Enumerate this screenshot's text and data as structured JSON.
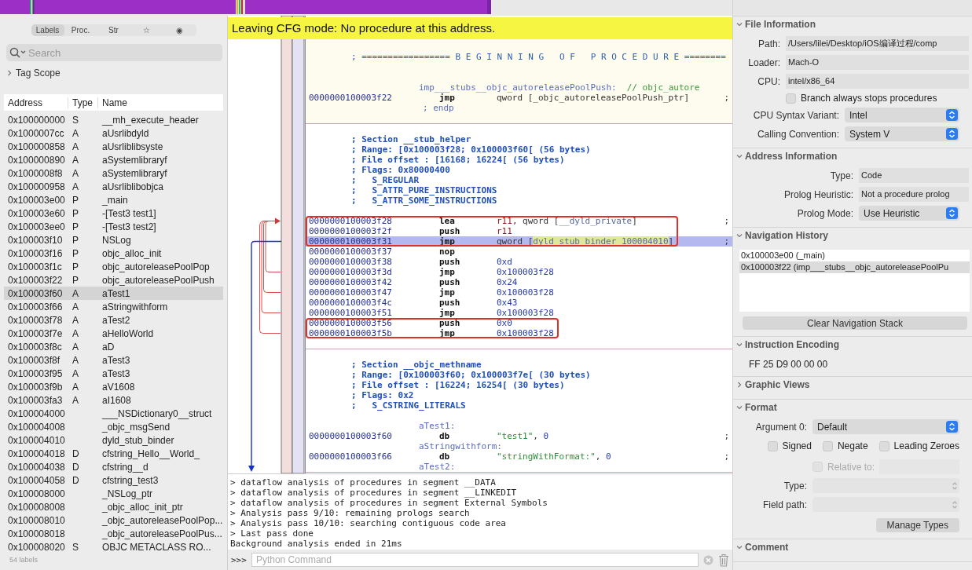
{
  "sidebar": {
    "tabs": [
      {
        "label": "Labels",
        "selected": true
      },
      {
        "label": "Proc.",
        "selected": false
      },
      {
        "label": "Str",
        "selected": false
      },
      {
        "label": "☆",
        "selected": false
      },
      {
        "label": "◉",
        "selected": false
      }
    ],
    "search": {
      "placeholder": "Search"
    },
    "tag_scope": {
      "label": "Tag Scope",
      "expanded": false
    },
    "table": {
      "columns": [
        "Address",
        "Type",
        "Name"
      ],
      "rows": [
        {
          "address": "0x100000000",
          "type": "S",
          "name": "__mh_execute_header",
          "selected": false
        },
        {
          "address": "0x1000007cc",
          "type": "A",
          "name": "aUsrlibdyld",
          "selected": false
        },
        {
          "address": "0x100000858",
          "type": "A",
          "name": "aUsrliblibsyste",
          "selected": false
        },
        {
          "address": "0x100000890",
          "type": "A",
          "name": "aSystemlibraryf",
          "selected": false
        },
        {
          "address": "0x1000008f8",
          "type": "A",
          "name": "aSystemlibraryf",
          "selected": false
        },
        {
          "address": "0x100000958",
          "type": "A",
          "name": "aUsrliblibobjca",
          "selected": false
        },
        {
          "address": "0x100003e00",
          "type": "P",
          "name": "_main",
          "selected": false
        },
        {
          "address": "0x100003e60",
          "type": "P",
          "name": "-[Test3 test1]",
          "selected": false
        },
        {
          "address": "0x100003ee0",
          "type": "P",
          "name": "-[Test3 test2]",
          "selected": false
        },
        {
          "address": "0x100003f10",
          "type": "P",
          "name": "NSLog",
          "selected": false
        },
        {
          "address": "0x100003f16",
          "type": "P",
          "name": "objc_alloc_init",
          "selected": false
        },
        {
          "address": "0x100003f1c",
          "type": "P",
          "name": "objc_autoreleasePoolPop",
          "selected": false
        },
        {
          "address": "0x100003f22",
          "type": "P",
          "name": "objc_autoreleasePoolPush",
          "selected": false
        },
        {
          "address": "0x100003f60",
          "type": "A",
          "name": "aTest1",
          "selected": true
        },
        {
          "address": "0x100003f66",
          "type": "A",
          "name": "aStringwithform",
          "selected": false
        },
        {
          "address": "0x100003f78",
          "type": "A",
          "name": "aTest2",
          "selected": false
        },
        {
          "address": "0x100003f7e",
          "type": "A",
          "name": "aHelloWorld",
          "selected": false
        },
        {
          "address": "0x100003f8c",
          "type": "A",
          "name": "aD",
          "selected": false
        },
        {
          "address": "0x100003f8f",
          "type": "A",
          "name": "aTest3",
          "selected": false
        },
        {
          "address": "0x100003f95",
          "type": "A",
          "name": "aTest3",
          "selected": false
        },
        {
          "address": "0x100003f9b",
          "type": "A",
          "name": "aV1608",
          "selected": false
        },
        {
          "address": "0x100003fa3",
          "type": "A",
          "name": "aI1608",
          "selected": false
        },
        {
          "address": "0x100004000",
          "name": "___NSDictionary0__struct",
          "selected": false
        },
        {
          "address": "0x100004008",
          "name": "_objc_msgSend",
          "selected": false
        },
        {
          "address": "0x100004010",
          "name": "dyld_stub_binder",
          "selected": false
        },
        {
          "address": "0x100004018",
          "type": "D",
          "name": "cfstring_Hello__World_",
          "selected": false
        },
        {
          "address": "0x100004038",
          "type": "D",
          "name": "cfstring__d",
          "selected": false
        },
        {
          "address": "0x100004058",
          "type": "D",
          "name": "cfstring_test3",
          "selected": false
        },
        {
          "address": "0x100008000",
          "name": "_NSLog_ptr",
          "selected": false
        },
        {
          "address": "0x100008008",
          "name": "_objc_alloc_init_ptr",
          "selected": false
        },
        {
          "address": "0x100008010",
          "name": "_objc_autoreleasePoolPop...",
          "selected": false
        },
        {
          "address": "0x100008018",
          "name": "_objc_autoreleasePoolPus...",
          "selected": false
        },
        {
          "address": "0x100008020",
          "type": "S",
          "name": "OBJC  METACLASS  RO...",
          "selected": false
        }
      ]
    },
    "footer": "54 labels"
  },
  "disassembly": {
    "banner": "Leaving CFG mode: No procedure at this address.",
    "blocks": [
      {
        "kind": "procedure",
        "lines": [
          {
            "kind": "heading",
            "text": "; ================= B E G I N N I N G   O F   P R O C E D U R E ========"
          },
          {
            "kind": "blank"
          },
          {
            "kind": "blank"
          },
          {
            "kind": "label",
            "text": "imp___stubs__objc_autoreleasePoolPush:",
            "note": "// objc_autore"
          },
          {
            "kind": "instr",
            "address": "0000000100003f22",
            "mnemonic": "jmp",
            "operands": [
              {
                "kind": "plain",
                "text": "qword [_objc_autoreleasePoolPush_ptr]"
              }
            ],
            "tail": ";",
            "selected": false
          },
          {
            "kind": "end",
            "text": "; endp"
          },
          {
            "kind": "blank"
          }
        ]
      },
      {
        "kind": "section",
        "lines": [
          {
            "kind": "blank"
          },
          {
            "kind": "comment",
            "text": "; Section __stub_helper"
          },
          {
            "kind": "comment",
            "text": "; Range: [0x100003f28; 0x100003f60[ (56 bytes)"
          },
          {
            "kind": "comment",
            "text": "; File offset : [16168; 16224[ (56 bytes)"
          },
          {
            "kind": "comment",
            "text": "; Flags: 0x80000400"
          },
          {
            "kind": "comment",
            "text": ";   S_REGULAR"
          },
          {
            "kind": "comment",
            "text": ";   S_ATTR_PURE_INSTRUCTIONS"
          },
          {
            "kind": "comment",
            "text": ";   S_ATTR_SOME_INSTRUCTIONS"
          },
          {
            "kind": "blank"
          },
          {
            "kind": "box",
            "lines": [
              {
                "kind": "instr",
                "address": "0000000100003f28",
                "mnemonic": "lea",
                "operands": [
                  {
                    "kind": "reg",
                    "text": "r11"
                  },
                  {
                    "kind": "plain",
                    "text": ", qword ["
                  },
                  {
                    "kind": "sym",
                    "text": "__dyld_private"
                  },
                  {
                    "kind": "plain",
                    "text": "]"
                  }
                ],
                "tail": ";",
                "selected": false
              },
              {
                "kind": "instr",
                "address": "0000000100003f2f",
                "mnemonic": "push",
                "operands": [
                  {
                    "kind": "reg",
                    "text": "r11"
                  }
                ],
                "selected": false
              },
              {
                "kind": "instr",
                "address": "0000000100003f31",
                "mnemonic": "jmp",
                "operands": [
                  {
                    "kind": "plain",
                    "text": "qword ["
                  },
                  {
                    "kind": "hl",
                    "text": "dyld_stub_binder_100004010"
                  },
                  {
                    "kind": "plain",
                    "text": "]"
                  }
                ],
                "tail": ";",
                "selected": true
              }
            ]
          },
          {
            "kind": "instr",
            "address": "0000000100003f37",
            "mnemonic": "nop",
            "selected": false
          },
          {
            "kind": "instr",
            "address": "0000000100003f38",
            "mnemonic": "push",
            "operands": [
              {
                "kind": "num",
                "text": "0xd"
              }
            ],
            "selected": false
          },
          {
            "kind": "instr",
            "address": "0000000100003f3d",
            "mnemonic": "jmp",
            "operands": [
              {
                "kind": "num",
                "text": "0x100003f28"
              }
            ],
            "selected": false
          },
          {
            "kind": "instr",
            "address": "0000000100003f42",
            "mnemonic": "push",
            "operands": [
              {
                "kind": "num",
                "text": "0x24"
              }
            ],
            "selected": false
          },
          {
            "kind": "instr",
            "address": "0000000100003f47",
            "mnemonic": "jmp",
            "operands": [
              {
                "kind": "num",
                "text": "0x100003f28"
              }
            ],
            "selected": false
          },
          {
            "kind": "instr",
            "address": "0000000100003f4c",
            "mnemonic": "push",
            "operands": [
              {
                "kind": "num",
                "text": "0x43"
              }
            ],
            "selected": false
          },
          {
            "kind": "instr",
            "address": "0000000100003f51",
            "mnemonic": "jmp",
            "operands": [
              {
                "kind": "num",
                "text": "0x100003f28"
              }
            ],
            "selected": false
          },
          {
            "kind": "box",
            "lines": [
              {
                "kind": "instr",
                "address": "0000000100003f56",
                "mnemonic": "push",
                "operands": [
                  {
                    "kind": "num",
                    "text": "0x0"
                  }
                ],
                "selected": false
              },
              {
                "kind": "instr",
                "address": "0000000100003f5b",
                "mnemonic": "jmp",
                "operands": [
                  {
                    "kind": "num",
                    "text": "0x100003f28"
                  }
                ],
                "selected": false
              }
            ]
          },
          {
            "kind": "blank"
          }
        ]
      },
      {
        "kind": "section",
        "lines": [
          {
            "kind": "blank"
          },
          {
            "kind": "comment",
            "text": "; Section __objc_methname"
          },
          {
            "kind": "comment",
            "text": "; Range: [0x100003f60; 0x100003f7e[ (30 bytes)"
          },
          {
            "kind": "comment",
            "text": "; File offset : [16224; 16254[ (30 bytes)"
          },
          {
            "kind": "comment",
            "text": "; Flags: 0x2"
          },
          {
            "kind": "comment",
            "text": ";   S_CSTRING_LITERALS"
          },
          {
            "kind": "blank"
          },
          {
            "kind": "label",
            "text": "aTest1:"
          },
          {
            "kind": "instr",
            "address": "0000000100003f60",
            "mnemonic": "db",
            "operands": [
              {
                "kind": "str",
                "text": "\"test1\""
              },
              {
                "kind": "plain",
                "text": ", "
              },
              {
                "kind": "num",
                "text": "0"
              }
            ],
            "tail": ";",
            "selected": false
          },
          {
            "kind": "label",
            "text": "aStringwithform:"
          },
          {
            "kind": "instr",
            "address": "0000000100003f66",
            "mnemonic": "db",
            "operands": [
              {
                "kind": "str",
                "text": "\"stringWithFormat:\""
              },
              {
                "kind": "plain",
                "text": ", "
              },
              {
                "kind": "num",
                "text": "0"
              }
            ],
            "tail": ";",
            "selected": false
          },
          {
            "kind": "label",
            "text": "aTest2:"
          }
        ]
      }
    ]
  },
  "console": {
    "lines": [
      "> dataflow analysis of procedures in segment __DATA",
      "> dataflow analysis of procedures in segment __LINKEDIT",
      "> dataflow analysis of procedures in segment External Symbols",
      "> Analysis pass 9/10: remaining prologs search",
      "> Analysis pass 10/10: searching contiguous code area",
      "> Last pass done",
      "Background analysis ended in 21ms"
    ],
    "prompt": ">>>",
    "placeholder": "Python Command"
  },
  "inspector": {
    "sections": [
      {
        "title": "File Information",
        "expanded": true,
        "rows": [
          {
            "kind": "field",
            "label": "Path:",
            "value": "/Users/lilei/Desktop/iOS编译过程/comp"
          },
          {
            "kind": "field",
            "label": "Loader:",
            "value": "Mach-O"
          },
          {
            "kind": "field",
            "label": "CPU:",
            "value": "intel/x86_64"
          },
          {
            "kind": "checkbox",
            "label": "Branch always stops procedures",
            "checked": false
          },
          {
            "kind": "popup",
            "label": "CPU Syntax Variant:",
            "value": "Intel",
            "disabled": false
          },
          {
            "kind": "popup",
            "label": "Calling Convention:",
            "value": "System V",
            "disabled": false
          }
        ]
      },
      {
        "title": "Address Information",
        "expanded": true,
        "rows": [
          {
            "kind": "field",
            "label": "Type:",
            "value": "Code"
          },
          {
            "kind": "field",
            "label": "Prolog Heuristic:",
            "value": "Not a procedure prolog"
          },
          {
            "kind": "popup",
            "label": "Prolog Mode:",
            "value": "Use Heuristic",
            "disabled": false
          }
        ]
      },
      {
        "title": "Navigation History",
        "expanded": true,
        "rows": [
          {
            "kind": "list",
            "items": [
              {
                "text": "0x100003e00 (_main)",
                "selected": false
              },
              {
                "text": "0x100003f22 (imp___stubs__objc_autoreleasePoolPu",
                "selected": true
              }
            ]
          },
          {
            "kind": "wide_button",
            "label": "Clear Navigation Stack"
          }
        ]
      },
      {
        "title": "Instruction Encoding",
        "expanded": true,
        "rows": [
          {
            "kind": "text",
            "text": "FF 25 D9 00 00 00"
          }
        ]
      },
      {
        "title": "Graphic Views",
        "expanded": false
      },
      {
        "title": "Format",
        "expanded": true,
        "rows": [
          {
            "kind": "popup",
            "label": "Argument 0:",
            "value": "Default",
            "disabled": false
          },
          {
            "kind": "checks",
            "items": [
              {
                "label": "Signed",
                "checked": false
              },
              {
                "label": "Negate",
                "checked": false
              },
              {
                "label": "Leading Zeroes",
                "checked": false
              }
            ]
          },
          {
            "kind": "checkfield",
            "label": "Relative to:",
            "checked": false,
            "disabled": true
          },
          {
            "kind": "popup",
            "label": "Type:",
            "disabled": true
          },
          {
            "kind": "popup",
            "label": "Field path:",
            "disabled": true
          },
          {
            "kind": "button",
            "label": "Manage Types"
          }
        ]
      },
      {
        "title": "Comment",
        "expanded": true
      }
    ]
  }
}
